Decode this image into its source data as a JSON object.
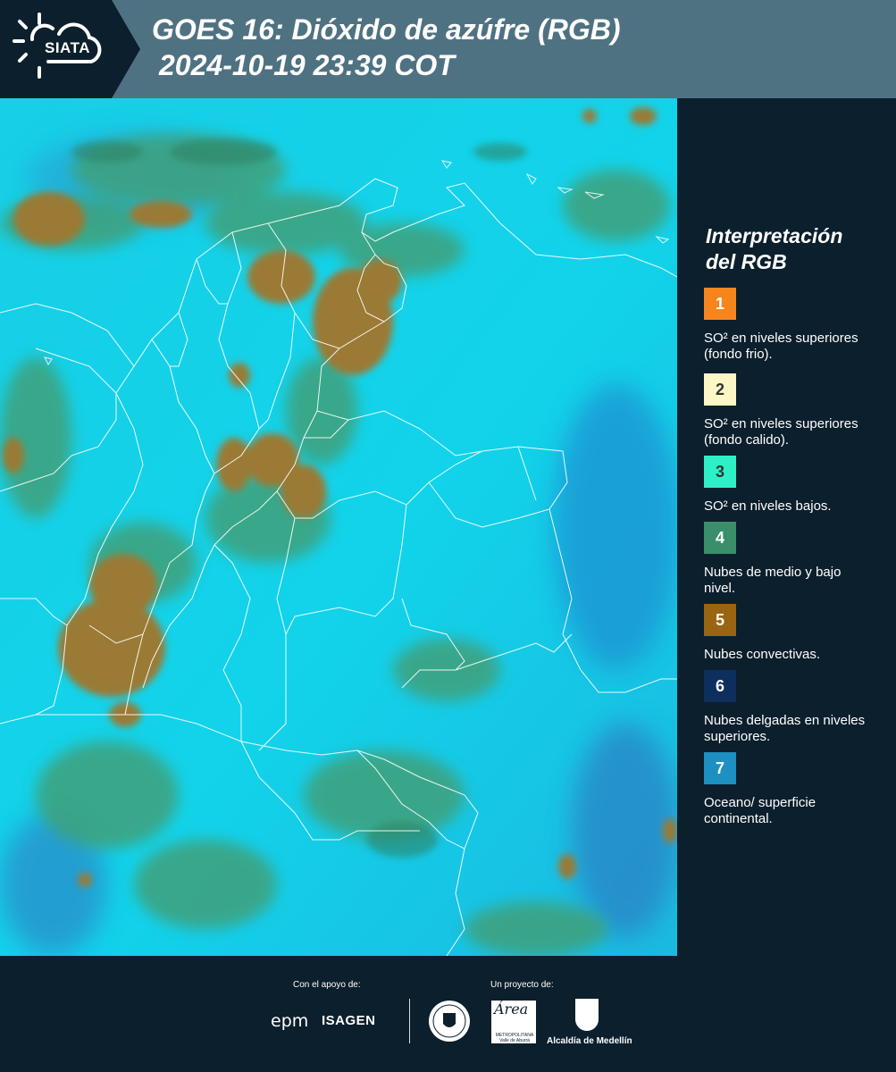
{
  "header": {
    "logo_text": "SIATA",
    "title_line1": "GOES 16: Dióxido de azúfre (RGB)",
    "title_line2": "2024-10-19 23:39 COT"
  },
  "legend": {
    "title": "Interpretación del RGB",
    "items": [
      {
        "number": "1",
        "color": "#f7851e",
        "text": "SO² en niveles superiores (fondo frio)."
      },
      {
        "number": "2",
        "color": "#fdf7c6",
        "text": "SO² en niveles superiores (fondo calido)."
      },
      {
        "number": "3",
        "color": "#2ef0c7",
        "text": "SO² en niveles bajos."
      },
      {
        "number": "4",
        "color": "#3a8f6a",
        "text": "Nubes de medio y bajo nivel."
      },
      {
        "number": "5",
        "color": "#9a6512",
        "text": "Nubes convectivas."
      },
      {
        "number": "6",
        "color": "#0d2f5e",
        "text": "Nubes delgadas en niveles superiores."
      },
      {
        "number": "7",
        "color": "#1d8fc0",
        "text": "Oceano/ superficie continental."
      }
    ]
  },
  "footer": {
    "support_label": "Con el apoyo de:",
    "project_label": "Un proyecto de:",
    "epm": "epm",
    "isagen": "ISAGEN",
    "area_logo": "Área",
    "area_sub": "METROPOLITANA Valle de Aburrá",
    "alcaldia": "Alcaldía de Medellín"
  },
  "colors": {
    "background": "#0c1f2c",
    "header_band": "#4f7282",
    "map_cyan": "#14d6e8",
    "cloud_brown": "#9a7a36",
    "cloud_green": "#3fa07a",
    "border_line": "#ffffff"
  },
  "icons": [
    "siata-sun-cloud-icon",
    "epm-logo",
    "isagen-logo",
    "medellin-seal",
    "area-metropolitana-logo",
    "alcaldia-medellin-shield"
  ]
}
